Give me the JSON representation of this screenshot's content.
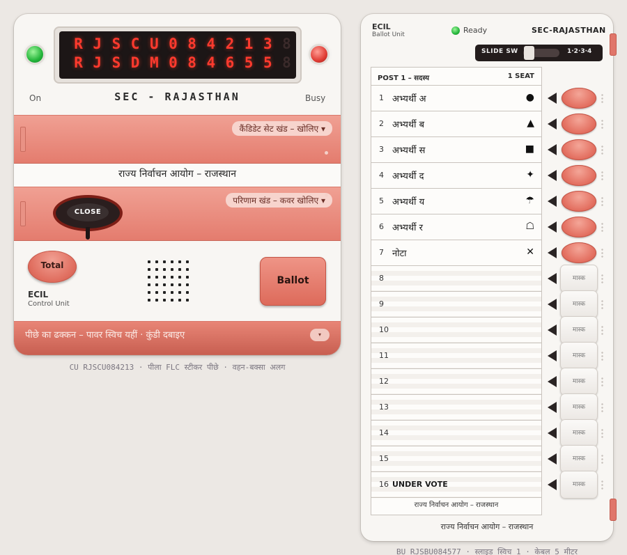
{
  "control_unit": {
    "display_line1": [
      "R",
      "J",
      "S",
      "C",
      "U",
      "0",
      "8",
      "4",
      "2",
      "1",
      "3",
      "8"
    ],
    "display_line2": [
      "R",
      "J",
      "S",
      "D",
      "M",
      "0",
      "8",
      "4",
      "6",
      "5",
      "5",
      "8"
    ],
    "label_on": "On",
    "label_busy": "Busy",
    "title": "SEC - RAJASTHAN",
    "candidate_set_label": "कैंडिडेट सेट खंड – खोलिए ▾",
    "commission_text": "राज्य निर्वाचन आयोग – राजस्थान",
    "result_label": "परिणाम खंड – कवर खोलिए ▾",
    "close_label": "CLOSE",
    "total_label": "Total",
    "ballot_label": "Ballot",
    "ecil": "ECIL",
    "unit_name": "Control Unit",
    "back_text": "पीछे का ढक्कन – पावर स्विच यहीं · कुंडी दबाइए",
    "back_toggle": "▾",
    "caption": "CU RJSCU084213 · पीला FLC स्टीकर पीछे · वहन-बक्सा अलग"
  },
  "ballot_unit": {
    "ecil": "ECIL",
    "unit_name": "Ballot Unit",
    "status": "Ready",
    "sec": "SEC-RAJASTHAN",
    "slide_label": "SLIDE SW",
    "slide_positions": "1·2·3·4",
    "post": "POST 1 – सदस्य",
    "seats": "1 SEAT",
    "rows": [
      {
        "num": "1",
        "name": "अभ्यर्थी अ",
        "symbol": "●",
        "button": "active"
      },
      {
        "num": "2",
        "name": "अभ्यर्थी ब",
        "symbol": "▲",
        "button": "active"
      },
      {
        "num": "3",
        "name": "अभ्यर्थी स",
        "symbol": "■",
        "button": "active"
      },
      {
        "num": "4",
        "name": "अभ्यर्थी द",
        "symbol": "✦",
        "button": "active"
      },
      {
        "num": "5",
        "name": "अभ्यर्थी य",
        "symbol": "☂",
        "button": "active"
      },
      {
        "num": "6",
        "name": "अभ्यर्थी र",
        "symbol": "☖",
        "button": "active"
      },
      {
        "num": "7",
        "name": "नोटा",
        "symbol": "✕",
        "button": "active"
      },
      {
        "num": "8",
        "name": "",
        "symbol": "",
        "button": "मास्क"
      },
      {
        "num": "9",
        "name": "",
        "symbol": "",
        "button": "मास्क"
      },
      {
        "num": "10",
        "name": "",
        "symbol": "",
        "button": "मास्क"
      },
      {
        "num": "11",
        "name": "",
        "symbol": "",
        "button": "मास्क"
      },
      {
        "num": "12",
        "name": "",
        "symbol": "",
        "button": "मास्क"
      },
      {
        "num": "13",
        "name": "",
        "symbol": "",
        "button": "मास्क"
      },
      {
        "num": "14",
        "name": "",
        "symbol": "",
        "button": "मास्क"
      },
      {
        "num": "15",
        "name": "",
        "symbol": "",
        "button": "मास्क"
      },
      {
        "num": "16",
        "name": "UNDER VOTE",
        "symbol": "",
        "button": "मास्क"
      }
    ],
    "paper_footer": "राज्य निर्वाचन आयोग – राजस्थान",
    "footer": "राज्य निर्वाचन आयोग – राजस्थान",
    "caption": "BU RJSBU084577 · स्लाइड स्विच 1 · केबल 5 मीटर"
  },
  "colors": {
    "accent": "#e47c6e",
    "led_red": "#ff3a2e",
    "lamp_green": "#23b53a",
    "lamp_red": "#e03c34"
  }
}
